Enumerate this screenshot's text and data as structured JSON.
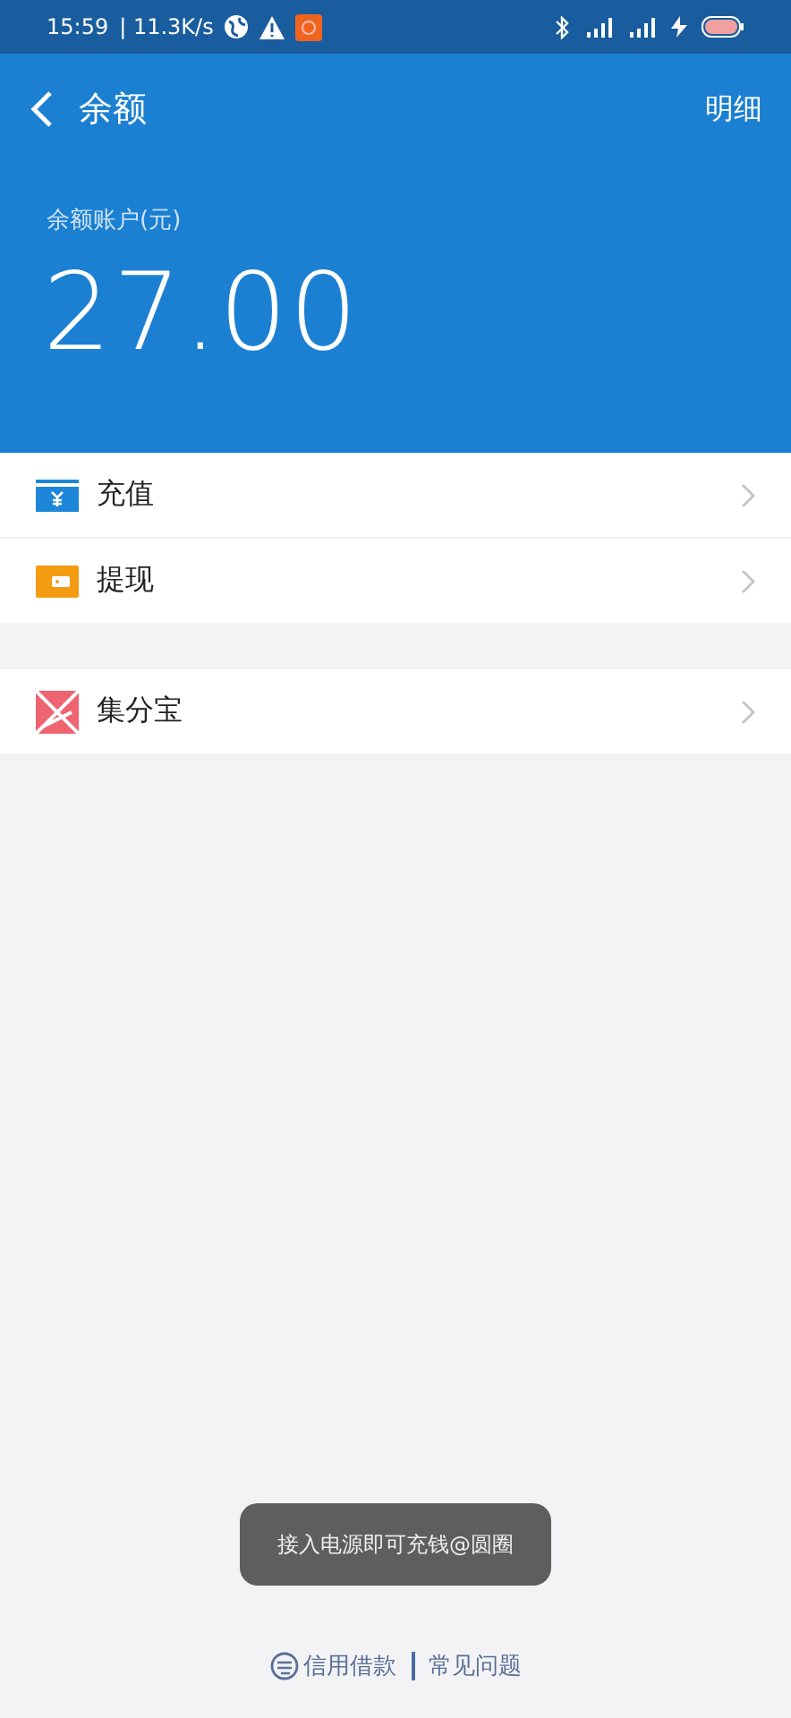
{
  "status_bar": {
    "time": "15:59",
    "speed": "| 11.3K/s"
  },
  "header": {
    "title": "余额",
    "action": "明细"
  },
  "balance": {
    "label": "余额账户(元)",
    "amount": "27.00"
  },
  "groups": [
    [
      {
        "kind": "recharge",
        "label": "充值"
      },
      {
        "kind": "withdraw",
        "label": "提现"
      }
    ],
    [
      {
        "kind": "points",
        "label": "集分宝"
      }
    ]
  ],
  "toast": "接入电源即可充钱@圆圈",
  "footer": {
    "brand": "信用借款",
    "link": "常见问题"
  }
}
